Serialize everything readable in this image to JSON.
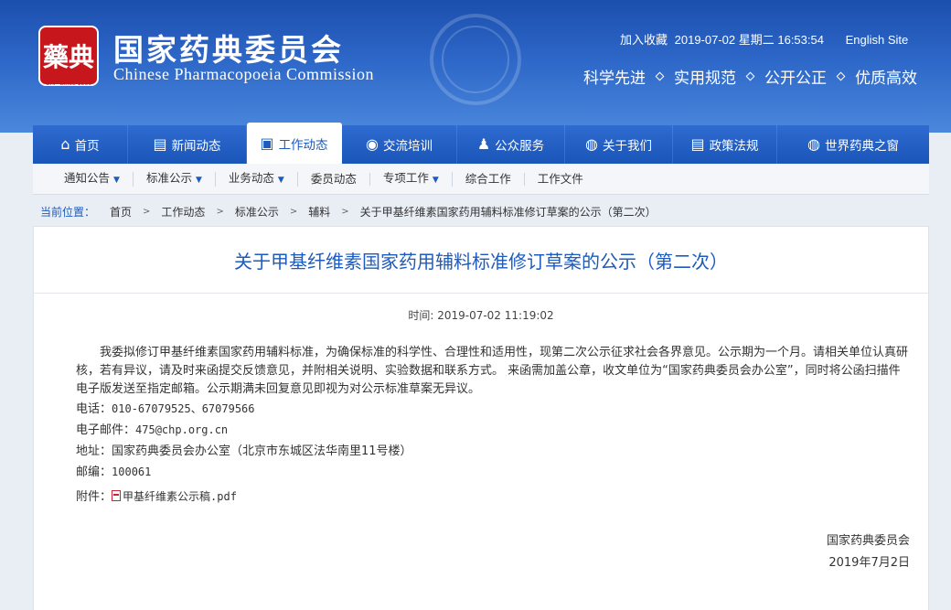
{
  "header": {
    "seal_text": "藥典",
    "seal_sub": "ChP Since 1950",
    "site_name_cn": "国家药典委员会",
    "site_name_en": "Chinese Pharmacopoeia Commission",
    "add_favorite": "加入收藏",
    "datetime": "2019-07-02 星期二 16:53:54",
    "english_site": "English Site",
    "slogans": [
      "科学先进",
      "实用规范",
      "公开公正",
      "优质高效"
    ]
  },
  "main_nav": [
    {
      "label": "首页",
      "icon": "home-icon",
      "glyph": "⌂"
    },
    {
      "label": "新闻动态",
      "icon": "news-icon",
      "glyph": "▤"
    },
    {
      "label": "工作动态",
      "icon": "briefcase-icon",
      "glyph": "▣"
    },
    {
      "label": "交流培训",
      "icon": "chat-icon",
      "glyph": "◉"
    },
    {
      "label": "公众服务",
      "icon": "users-icon",
      "glyph": "♟"
    },
    {
      "label": "关于我们",
      "icon": "globe-icon",
      "glyph": "◍"
    },
    {
      "label": "政策法规",
      "icon": "document-icon",
      "glyph": "▤"
    },
    {
      "label": "世界药典之窗",
      "icon": "world-icon",
      "glyph": "◍"
    }
  ],
  "sub_nav": [
    {
      "label": "通知公告",
      "dropdown": true
    },
    {
      "label": "标准公示",
      "dropdown": true
    },
    {
      "label": "业务动态",
      "dropdown": true
    },
    {
      "label": "委员动态",
      "dropdown": false
    },
    {
      "label": "专项工作",
      "dropdown": true
    },
    {
      "label": "综合工作",
      "dropdown": false
    },
    {
      "label": "工作文件",
      "dropdown": false
    }
  ],
  "breadcrumb": {
    "label": "当前位置：",
    "items": [
      "首页",
      "工作动态",
      "标准公示",
      "辅料",
      "关于甲基纤维素国家药用辅料标准修订草案的公示（第二次）"
    ]
  },
  "article": {
    "title": "关于甲基纤维素国家药用辅料标准修订草案的公示（第二次）",
    "time": "时间: 2019-07-02 11:19:02",
    "paragraph": "我委拟修订甲基纤维素国家药用辅料标准，为确保标准的科学性、合理性和适用性，现第二次公示征求社会各界意见。公示期为一个月。请相关单位认真研核，若有异议，请及时来函提交反馈意见，并附相关说明、实验数据和联系方式。 来函需加盖公章，收文单位为“国家药典委员会办公室”，同时将公函扫描件电子版发送至指定邮箱。公示期满未回复意见即视为对公示标准草案无异议。",
    "phone_key": "电话：",
    "phone": "010-67079525、67079566",
    "email_key": "电子邮件：",
    "email": "475@chp.org.cn",
    "address_key": "地址：",
    "address": "国家药典委员会办公室（北京市东城区法华南里11号楼）",
    "zip_key": "邮编：",
    "zip": "100061",
    "attach_key": "附件：",
    "attachment": "甲基纤维素公示稿.pdf",
    "signer": "国家药典委员会",
    "date": "2019年7月2日"
  }
}
